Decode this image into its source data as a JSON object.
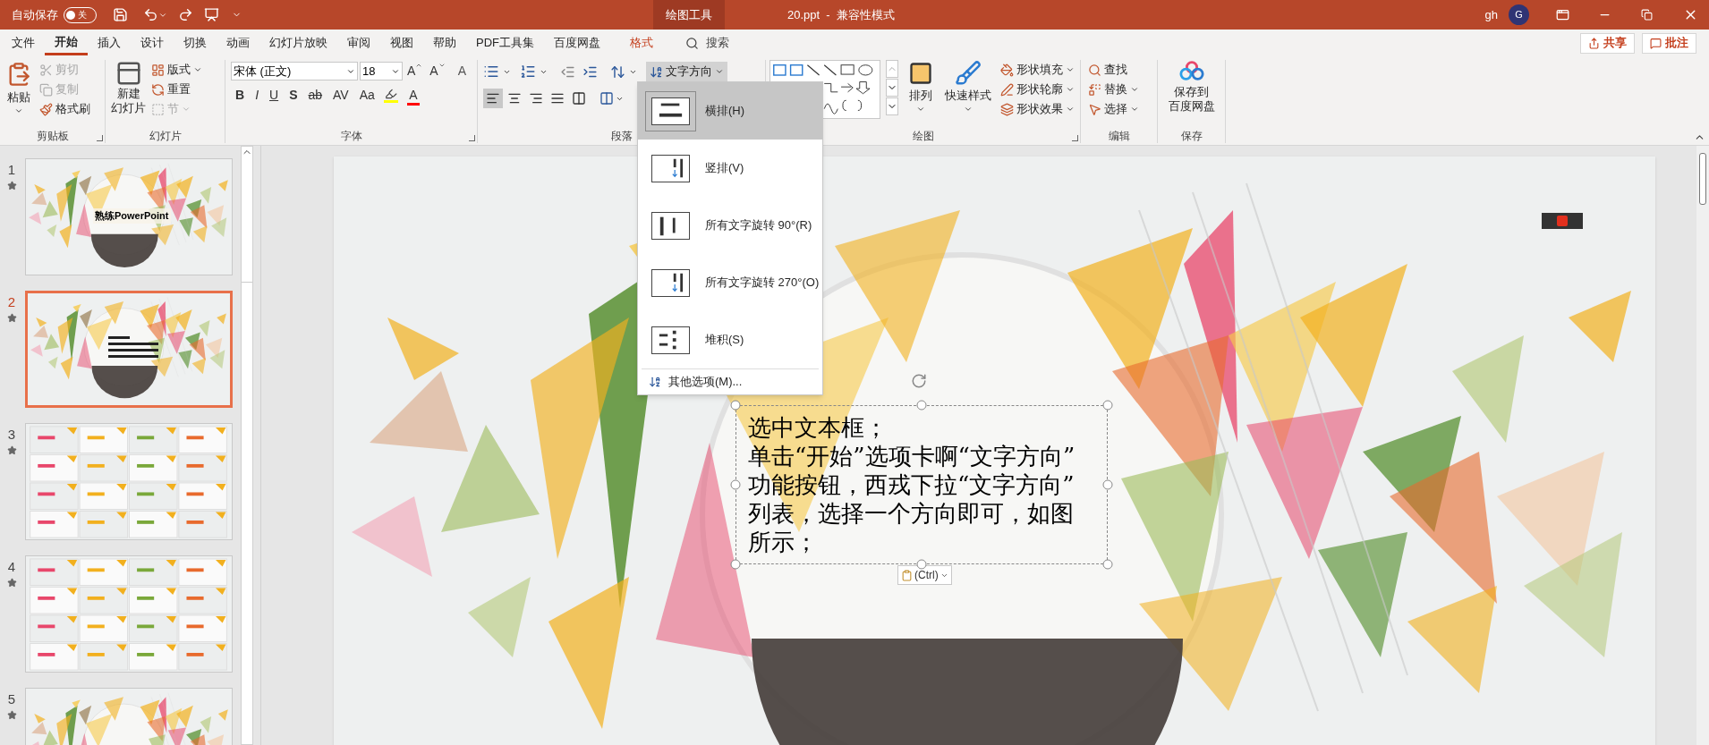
{
  "title_bar": {
    "autosave_label": "自动保存",
    "autosave": {
      "on": false,
      "label": "关"
    },
    "context_label": "绘图工具",
    "title": "20.ppt  -  兼容性模式",
    "user": "gh",
    "avatar": "G"
  },
  "tabs": [
    {
      "label": "文件",
      "selected": false,
      "kind": "normal"
    },
    {
      "label": "开始",
      "selected": true,
      "kind": "normal"
    },
    {
      "label": "插入",
      "selected": false,
      "kind": "normal"
    },
    {
      "label": "设计",
      "selected": false,
      "kind": "normal"
    },
    {
      "label": "切换",
      "selected": false,
      "kind": "normal"
    },
    {
      "label": "动画",
      "selected": false,
      "kind": "normal"
    },
    {
      "label": "幻灯片放映",
      "selected": false,
      "kind": "normal"
    },
    {
      "label": "审阅",
      "selected": false,
      "kind": "normal"
    },
    {
      "label": "视图",
      "selected": false,
      "kind": "normal"
    },
    {
      "label": "帮助",
      "selected": false,
      "kind": "normal"
    },
    {
      "label": "PDF工具集",
      "selected": false,
      "kind": "normal"
    },
    {
      "label": "百度网盘",
      "selected": false,
      "kind": "normal"
    },
    {
      "label": "格式",
      "selected": false,
      "kind": "contextual"
    }
  ],
  "search": {
    "placeholder": "搜索"
  },
  "share_button": "共享",
  "comments_button": "批注",
  "ribbon": {
    "clipboard": {
      "title": "剪贴板",
      "paste": "粘贴",
      "items": [
        {
          "label": "剪切",
          "kind": "cut",
          "disabled": true
        },
        {
          "label": "复制",
          "kind": "copy",
          "disabled": true
        },
        {
          "label": "格式刷",
          "kind": "painter",
          "disabled": false
        }
      ]
    },
    "slides": {
      "title": "幻灯片",
      "new_slide": [
        "新建",
        "幻灯片"
      ],
      "items": [
        {
          "label": "版式",
          "kind": "layout",
          "disabled": false
        },
        {
          "label": "重置",
          "kind": "reset",
          "disabled": false
        },
        {
          "label": "节",
          "kind": "section",
          "disabled": true
        }
      ]
    },
    "font": {
      "title": "字体",
      "font_name": "宋体 (正文)",
      "font_size": "18",
      "size_buttons": [
        {
          "label": "A",
          "kind": "grow"
        },
        {
          "label": "A",
          "kind": "shrink"
        },
        {
          "label": "A",
          "kind": "clear"
        }
      ],
      "format_buttons": [
        {
          "label": "B",
          "kind": "bold"
        },
        {
          "label": "I",
          "kind": "italic"
        },
        {
          "label": "U",
          "kind": "underline"
        },
        {
          "label": "S",
          "kind": "shadow"
        },
        {
          "label": "ab",
          "kind": "strike"
        },
        {
          "label": "AV",
          "kind": "spacing"
        },
        {
          "label": "Aa",
          "kind": "case"
        },
        {
          "kind": "highlight"
        },
        {
          "label": "A",
          "kind": "color"
        }
      ]
    },
    "paragraph": {
      "title": "段落",
      "alignment": [
        {
          "kind": "left",
          "selected": true
        },
        {
          "kind": "center",
          "selected": false
        },
        {
          "kind": "right",
          "selected": false
        },
        {
          "kind": "justify",
          "selected": false
        },
        {
          "kind": "distributed",
          "selected": false
        }
      ],
      "text_direction": {
        "label": "文字方向",
        "expanded": true
      }
    },
    "drawing": {
      "title": "绘图",
      "arrange": "排列",
      "quick_styles": "快速样式",
      "shape_items": [
        {
          "label": "形状填充",
          "kind": "fill"
        },
        {
          "label": "形状轮廓",
          "kind": "outline"
        },
        {
          "label": "形状效果",
          "kind": "effect"
        }
      ]
    },
    "editing": {
      "title": "编辑",
      "items": [
        {
          "label": "查找",
          "kind": "find"
        },
        {
          "label": "替换",
          "kind": "replace"
        },
        {
          "label": "选择",
          "kind": "select"
        }
      ]
    },
    "save": {
      "title": "保存",
      "button": [
        "保存到",
        "百度网盘"
      ]
    }
  },
  "text_direction_menu": {
    "items": [
      {
        "label": "横排(H)",
        "kind": "horizontal",
        "selected": true
      },
      {
        "label": "竖排(V)",
        "kind": "vertical",
        "selected": false
      },
      {
        "label": "所有文字旋转 90°(R)",
        "kind": "rotate90",
        "selected": false
      },
      {
        "label": "所有文字旋转 270°(O)",
        "kind": "rotate270",
        "selected": false
      },
      {
        "label": "堆积(S)",
        "kind": "stacked",
        "selected": false
      }
    ],
    "more": "其他选项(M)..."
  },
  "slides": [
    {
      "number": "1",
      "selected": false,
      "kind": "cover",
      "title": "熟练PowerPoint"
    },
    {
      "number": "2",
      "selected": true,
      "kind": "textbox"
    },
    {
      "number": "3",
      "selected": false,
      "kind": "grid"
    },
    {
      "number": "4",
      "selected": false,
      "kind": "grid"
    },
    {
      "number": "5",
      "selected": false,
      "kind": "cover"
    }
  ],
  "slide": {
    "paragraphs": [
      "选中文本框；",
      "单击“开始”选项卡啊“文字方向”功能按钮，西戎下拉“文字方向”列表，选择一个方向即可，如图所示；"
    ],
    "paste_options": "(Ctrl)"
  }
}
